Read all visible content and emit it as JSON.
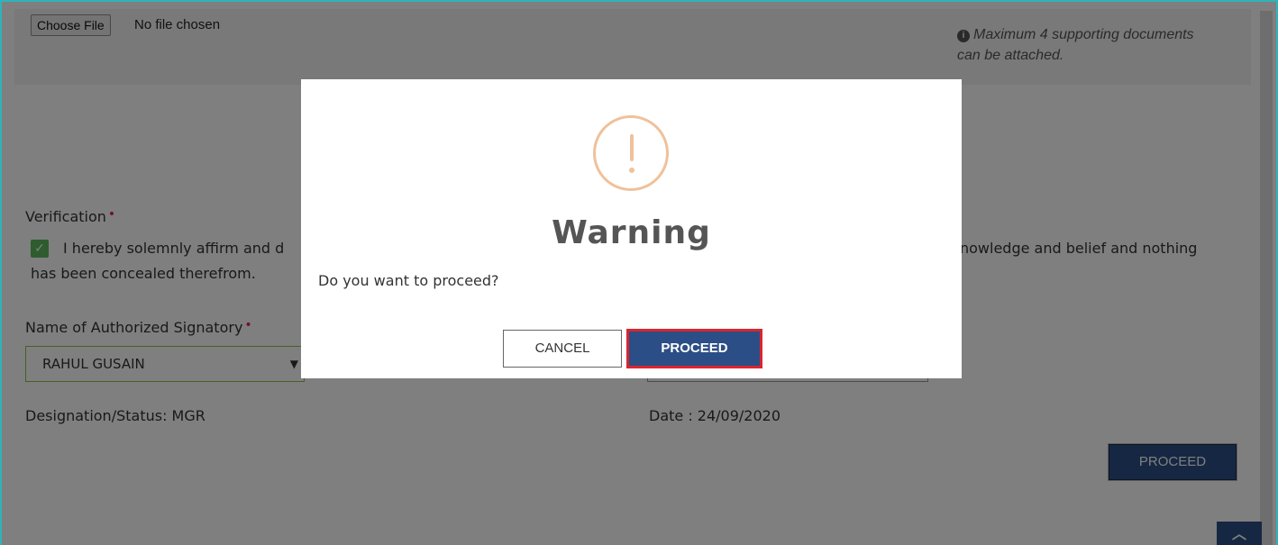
{
  "upload": {
    "choose_file_label": "Choose File",
    "file_status": "No file chosen",
    "hint": "Maximum 4 supporting documents can be attached.",
    "hint_icon": "info-icon"
  },
  "verification": {
    "label": "Verification",
    "required_mark": "•",
    "checked": true,
    "text_visible_left": "I hereby solemnly affirm and d",
    "text_visible_right": "nowledge and belief and nothing",
    "text_line2": "has been concealed therefrom."
  },
  "signatory": {
    "label": "Name of Authorized Signatory",
    "required_mark": "•",
    "selected": "RAHUL GUSAIN"
  },
  "designation": "Designation/Status: MGR",
  "date": "Date : 24/09/2020",
  "page_proceed_label": "PROCEED",
  "scroll_top_icon": "chevron-up-icon",
  "dialog": {
    "icon": "exclamation-circle-icon",
    "icon_color": "#f0c19b",
    "title": "Warning",
    "message": "Do you want to proceed?",
    "cancel_label": "CANCEL",
    "proceed_label": "PROCEED",
    "highlight_color": "#d9252f"
  },
  "colors": {
    "primary": "#2c4e86",
    "frame_border": "#2fb3b8",
    "checkbox": "#5cb85c",
    "required": "#e0245e"
  }
}
